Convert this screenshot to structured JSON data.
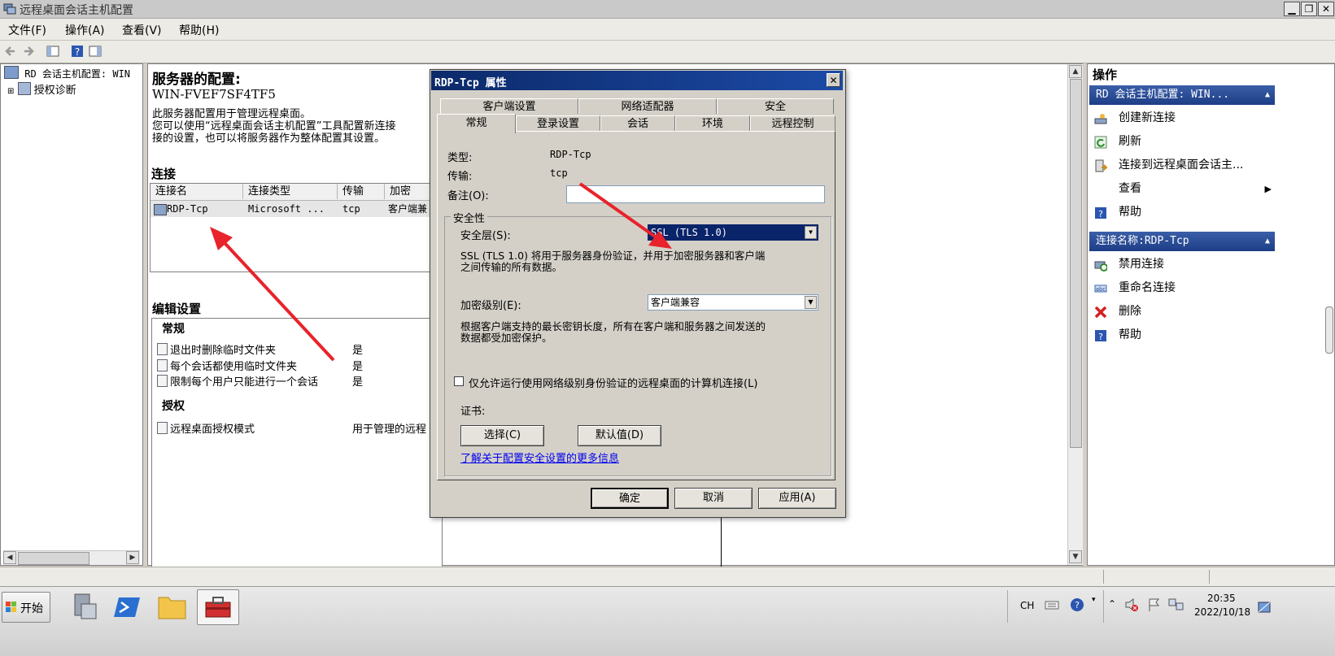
{
  "window": {
    "title": "远程桌面会话主机配置"
  },
  "menu": [
    "文件(F)",
    "操作(A)",
    "查看(V)",
    "帮助(H)"
  ],
  "tree": {
    "root": "RD 会话主机配置: WIN",
    "child": "授权诊断"
  },
  "server": {
    "heading": "服务器的配置:",
    "name": "WIN-FVEF7SF4TF5",
    "desc1": "此服务器配置用于管理远程桌面。",
    "desc2": "您可以使用“远程桌面会话主机配置”工具配置新连接",
    "desc3": "接的设置，也可以将服务器作为整体配置其设置。"
  },
  "connections": {
    "heading": "连接",
    "columns": [
      "连接名",
      "连接类型",
      "传输",
      "加密"
    ],
    "row": {
      "name": "RDP-Tcp",
      "type": "Microsoft ...",
      "transport": "tcp",
      "encryption": "客户端兼"
    }
  },
  "edit": {
    "heading": "编辑设置",
    "general": "常规",
    "items": [
      {
        "label": "退出时删除临时文件夹",
        "value": "是"
      },
      {
        "label": "每个会话都使用临时文件夹",
        "value": "是"
      },
      {
        "label": "限制每个用户只能进行一个会话",
        "value": "是"
      }
    ],
    "license_heading": "授权",
    "license_item": {
      "label": "远程桌面授权模式",
      "value": "用于管理的远程"
    }
  },
  "actions": {
    "heading": "操作",
    "group1": "RD 会话主机配置: WIN...",
    "group1_items": [
      "创建新连接",
      "刷新",
      "连接到远程桌面会话主...",
      "查看",
      "帮助"
    ],
    "group2": "连接名称:RDP-Tcp",
    "group2_items": [
      "禁用连接",
      "重命名连接",
      "删除",
      "帮助"
    ]
  },
  "dialog": {
    "title": "RDP-Tcp 属性",
    "tabs_row1": [
      "客户端设置",
      "网络适配器",
      "安全"
    ],
    "tabs_row2": [
      "常规",
      "登录设置",
      "会话",
      "环境",
      "远程控制"
    ],
    "type_label": "类型:",
    "type_value": "RDP-Tcp",
    "transport_label": "传输:",
    "transport_value": "tcp",
    "comment_label": "备注(O):",
    "comment_value": "",
    "security_group": "安全性",
    "security_layer_label": "安全层(S):",
    "security_layer_value": "SSL (TLS 1.0)",
    "security_desc1": "SSL (TLS 1.0) 将用于服务器身份验证，并用于加密服务器和客户端",
    "security_desc2": "之间传输的所有数据。",
    "encryption_label": "加密级别(E):",
    "encryption_value": "客户端兼容",
    "encryption_desc1": "根据客户端支持的最长密钥长度，所有在客户端和服务器之间发送的",
    "encryption_desc2": "数据都受加密保护。",
    "nla_label": "仅允许运行使用网络级别身份验证的远程桌面的计算机连接(L)",
    "nla_checked": false,
    "cert_label": "证书:",
    "select_button": "选择(C)",
    "default_button": "默认值(D)",
    "more_info_link": "了解关于配置安全设置的更多信息",
    "ok": "确定",
    "cancel": "取消",
    "apply": "应用(A)"
  },
  "taskbar": {
    "start": "开始",
    "lang": "CH",
    "time": "20:35",
    "date": "2022/10/18"
  },
  "colors": {
    "accent": "#1d3e86",
    "annotation": "#e8232b",
    "link": "#0000ee"
  }
}
